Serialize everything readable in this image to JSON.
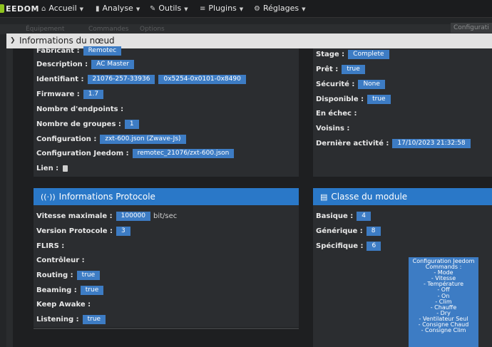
{
  "navbar": {
    "logo_text": "EEDOM",
    "items": [
      {
        "label": "Accueil",
        "icon": "home-icon",
        "glyph": "⌂"
      },
      {
        "label": "Analyse",
        "icon": "bar-chart-icon",
        "glyph": "▮"
      },
      {
        "label": "Outils",
        "icon": "wrench-icon",
        "glyph": "✎"
      },
      {
        "label": "Plugins",
        "icon": "list-icon",
        "glyph": "≡"
      },
      {
        "label": "Réglages",
        "icon": "gear-icon",
        "glyph": "⚙"
      }
    ]
  },
  "background": {
    "tabs": [
      "Équipement",
      "Commandes",
      "Options"
    ],
    "config_tab": "Configurati"
  },
  "modal": {
    "title": "Informations du nœud"
  },
  "node_info": {
    "fabricant": {
      "label": "Fabricant :",
      "value": "Remotec"
    },
    "description": {
      "label": "Description :",
      "value": "AC Master"
    },
    "identifiant": {
      "label": "Identifiant :",
      "value1": "21076-257-33936",
      "value2": "0x5254-0x0101-0x8490"
    },
    "firmware": {
      "label": "Firmware :",
      "value": "1.7"
    },
    "endpoints": {
      "label": "Nombre d'endpoints :"
    },
    "groupes": {
      "label": "Nombre de groupes :",
      "value": "1"
    },
    "configuration": {
      "label": "Configuration :",
      "value": "zxt-600.json (Zwave-Js)"
    },
    "config_jeedom": {
      "label": "Configuration Jeedom :",
      "value": "remotec_21076/zxt-600.json"
    },
    "lien": {
      "label": "Lien :"
    }
  },
  "node_status": {
    "stage": {
      "label": "Stage :",
      "value": "Complete"
    },
    "pret": {
      "label": "Prêt :",
      "value": "true"
    },
    "securite": {
      "label": "Sécurité :",
      "value": "None"
    },
    "disponible": {
      "label": "Disponible :",
      "value": "true"
    },
    "echec": {
      "label": "En échec :"
    },
    "voisins": {
      "label": "Voisins :"
    },
    "derniere": {
      "label": "Dernière activité :",
      "value": "17/10/2023 21:32:58"
    }
  },
  "protocol": {
    "title": "Informations Protocole",
    "vitesse": {
      "label": "Vitesse maximale :",
      "value": "100000",
      "unit": "bit/sec"
    },
    "version": {
      "label": "Version Protocole :",
      "value": "3"
    },
    "flirs": {
      "label": "FLIRS :"
    },
    "controleur": {
      "label": "Contrôleur :"
    },
    "routing": {
      "label": "Routing :",
      "value": "true"
    },
    "beaming": {
      "label": "Beaming :",
      "value": "true"
    },
    "keepawake": {
      "label": "Keep Awake :"
    },
    "listening": {
      "label": "Listening :",
      "value": "true"
    }
  },
  "module_class": {
    "title": "Classe du module",
    "basique": {
      "label": "Basique :",
      "value": "4"
    },
    "generique": {
      "label": "Générique :",
      "value": "8"
    },
    "specifique": {
      "label": "Spécifique :",
      "value": "6"
    }
  },
  "config_commands": {
    "lines": [
      "Configuration Jeedom",
      "Commands :",
      "- Mode",
      "- Vitesse",
      "- Température",
      "- Off",
      "- On",
      "- Clim",
      "- Chauffe",
      "- Dry",
      "- Ventilateur Seul",
      "- Consigne Chaud",
      "- Consigne Clim"
    ]
  },
  "colors": {
    "accent": "#2a78c8",
    "badge": "#3d7cc4",
    "background": "#242628"
  }
}
